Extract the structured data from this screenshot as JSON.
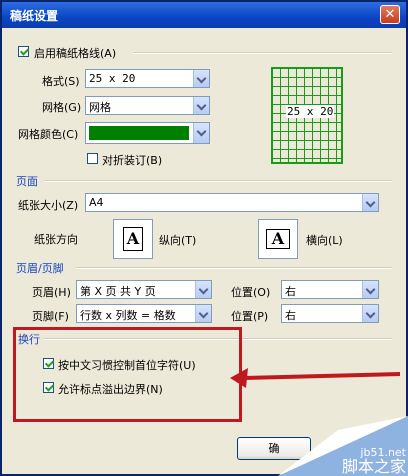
{
  "window": {
    "title": "稿纸设置",
    "close_icon": "close-icon"
  },
  "grid_enable": {
    "label": "启用稿纸格线(A)",
    "checked": true
  },
  "format": {
    "label": "格式(S)",
    "value": "25 x 20"
  },
  "style": {
    "label": "网格(G)",
    "value": "网格"
  },
  "grid_color": {
    "label": "网格颜色(C)",
    "color": "#008000"
  },
  "fold": {
    "label": "对折装订(B)",
    "checked": false
  },
  "preview": {
    "text": "25 x 20"
  },
  "page": {
    "section": "页面",
    "size_label": "纸张大小(Z)",
    "size_value": "A4",
    "orientation_label": "纸张方向",
    "portrait_label": "纵向(T)",
    "landscape_label": "横向(L)",
    "glyph": "A"
  },
  "header_footer": {
    "section": "页眉/页脚",
    "header_label": "页眉(H)",
    "header_value": "第 X 页 共 Y 页",
    "header_pos_label": "位置(O)",
    "header_pos_value": "右",
    "footer_label": "页脚(F)",
    "footer_value": "行数 x 列数 = 格数",
    "footer_pos_label": "位置(P)",
    "footer_pos_value": "右"
  },
  "wrap": {
    "section": "换行",
    "opt1": {
      "label": "按中文习惯控制首位字符(U)",
      "checked": true
    },
    "opt2": {
      "label": "允许标点溢出边界(N)",
      "checked": true
    }
  },
  "buttons": {
    "ok": "确"
  },
  "watermark": {
    "line1": "jb51.net",
    "line2": "脚本之家"
  }
}
